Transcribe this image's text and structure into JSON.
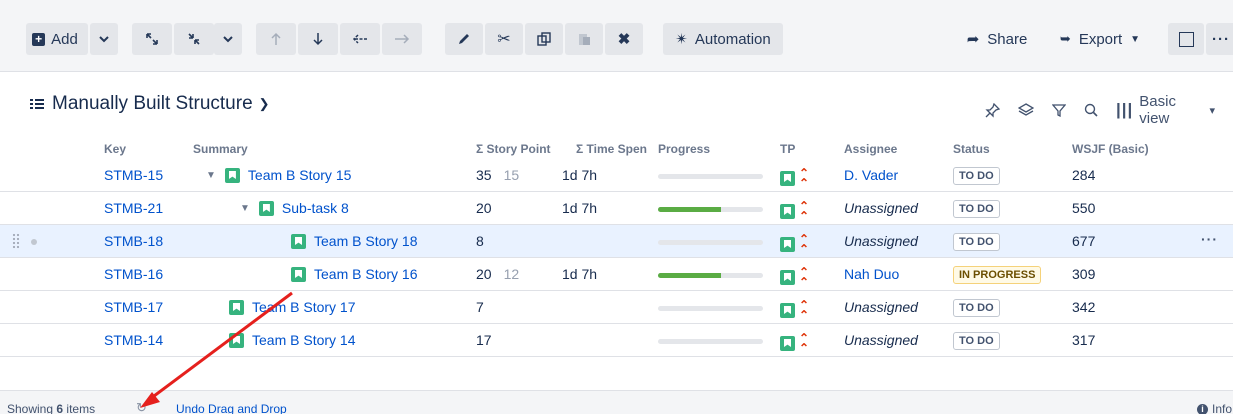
{
  "toolbar": {
    "add_label": "Add",
    "automation_label": "Automation",
    "share_label": "Share",
    "export_label": "Export"
  },
  "structure": {
    "title": "Manually Built Structure",
    "view_label": "Basic view"
  },
  "columns": {
    "key": "Key",
    "summary": "Summary",
    "story_points": "Σ Story Point",
    "time_spent": "Σ Time Spen",
    "progress": "Progress",
    "tp": "TP",
    "assignee": "Assignee",
    "status": "Status",
    "wsjf": "WSJF (Basic)"
  },
  "rows": [
    {
      "key": "STMB-15",
      "summary": "Team B Story 15",
      "sp": "35",
      "sp_sub": "15",
      "time": "1d 7h",
      "progress": 0,
      "assignee": "D. Vader",
      "status": "TO DO",
      "wsjf": "284"
    },
    {
      "key": "STMB-21",
      "summary": "Sub-task 8",
      "sp": "20",
      "sp_sub": "",
      "time": "1d 7h",
      "progress": 0.6,
      "assignee": "Unassigned",
      "status": "TO DO",
      "wsjf": "550"
    },
    {
      "key": "STMB-18",
      "summary": "Team B Story 18",
      "sp": "8",
      "sp_sub": "",
      "time": "",
      "progress": 0,
      "assignee": "Unassigned",
      "status": "TO DO",
      "wsjf": "677"
    },
    {
      "key": "STMB-16",
      "summary": "Team B Story 16",
      "sp": "20",
      "sp_sub": "12",
      "time": "1d 7h",
      "progress": 0.6,
      "assignee": "Nah Duo",
      "status": "IN PROGRESS",
      "wsjf": "309"
    },
    {
      "key": "STMB-17",
      "summary": "Team B Story 17",
      "sp": "7",
      "sp_sub": "",
      "time": "",
      "progress": 0,
      "assignee": "Unassigned",
      "status": "TO DO",
      "wsjf": "342"
    },
    {
      "key": "STMB-14",
      "summary": "Team B Story 14",
      "sp": "17",
      "sp_sub": "",
      "time": "",
      "progress": 0,
      "assignee": "Unassigned",
      "status": "TO DO",
      "wsjf": "317"
    }
  ],
  "footer": {
    "showing_prefix": "Showing ",
    "showing_count": "6",
    "showing_suffix": " items",
    "undo_label": "Undo Drag and Drop",
    "info_label": "Info"
  },
  "colors": {
    "accent": "#0052cc",
    "story_icon": "#36b37e",
    "progress_fill": "#5aac44",
    "annotation_arrow": "#e5201d"
  }
}
